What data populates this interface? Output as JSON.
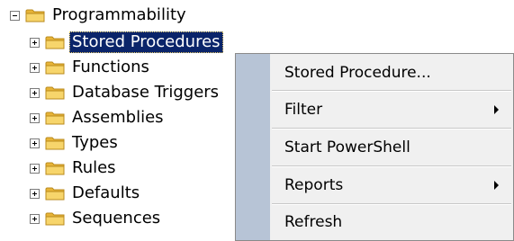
{
  "tree": {
    "root": {
      "label": "Programmability",
      "expanded": true
    },
    "children": [
      {
        "label": "Stored Procedures",
        "selected": true
      },
      {
        "label": "Functions"
      },
      {
        "label": "Database Triggers"
      },
      {
        "label": "Assemblies"
      },
      {
        "label": "Types"
      },
      {
        "label": "Rules"
      },
      {
        "label": "Defaults"
      },
      {
        "label": "Sequences"
      }
    ]
  },
  "context_menu": {
    "items": [
      {
        "label": "Stored Procedure...",
        "submenu": false
      },
      {
        "label": "Filter",
        "submenu": true
      },
      {
        "label": "Start PowerShell",
        "submenu": false
      },
      {
        "label": "Reports",
        "submenu": true
      },
      {
        "label": "Refresh",
        "submenu": false
      }
    ]
  },
  "colors": {
    "selection": "#0a246a",
    "menu_gutter": "#b7c4d6",
    "menu_background": "#f0f0f0",
    "folder": "#f2c34b"
  }
}
